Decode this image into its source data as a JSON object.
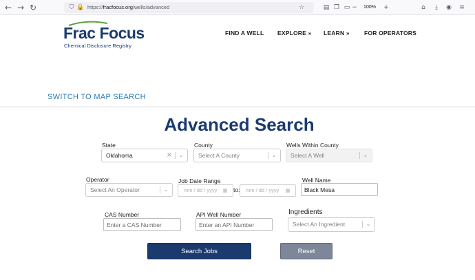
{
  "browser": {
    "url_host": "fracfocus.org",
    "url_path": "/wells/advanced",
    "url_scheme": "https://",
    "zoom": "100%",
    "icons": {
      "back": "←",
      "forward": "→",
      "reload": "↻",
      "shield": "⛉",
      "lock": "🔒",
      "bookmark": "☆",
      "reader": "▤",
      "extensions": "❐",
      "account": "▭",
      "zoom_out": "−",
      "zoom_in": "+",
      "pocket": "⌂",
      "download": "⤓",
      "profile": "◉",
      "menu": "≡"
    }
  },
  "site": {
    "logo_text": "Frac Focus",
    "logo_subtitle": "Chemical Disclosure Registry",
    "nav": [
      "FIND A WELL",
      "EXPLORE »",
      "LEARN »",
      "FOR OPERATORS"
    ]
  },
  "switch_link": "SWITCH TO MAP SEARCH",
  "page_title": "Advanced Search",
  "form": {
    "state_label": "State",
    "state_value": "Oklahoma",
    "county_label": "County",
    "county_placeholder": "Select A County",
    "wells_label": "Wells Within County",
    "wells_placeholder": "Select A Well",
    "operator_label": "Operator",
    "operator_placeholder": "Select An Operator",
    "job_date_label": "Job Date Range",
    "date_placeholder": "mm / dd / yyyy",
    "to_label": "to:",
    "well_name_label": "Well Name",
    "well_name_value": "Black Mesa",
    "cas_label": "CAS Number",
    "cas_placeholder": "Enter a CAS Number",
    "api_label": "API Well Number",
    "api_placeholder": "Enter an API Number",
    "ingredients_label": "Ingredients",
    "ingredients_placeholder": "Select An Ingredient",
    "search_button": "Search Jobs",
    "reset_button": "Reset"
  },
  "colors": {
    "brand": "#1b3b6f",
    "link": "#2a7ab8",
    "reset": "#7d8799"
  }
}
